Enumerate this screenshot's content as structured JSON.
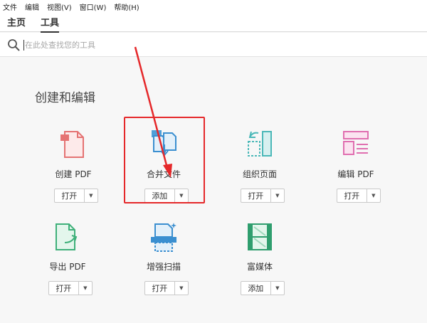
{
  "menu": [
    "文件",
    "编辑",
    "视图(V)",
    "窗口(W)",
    "帮助(H)"
  ],
  "tabs": {
    "home": "主页",
    "tools": "工具"
  },
  "search": {
    "placeholder": "在此处查找您的工具",
    "value": ""
  },
  "section": {
    "title": "创建和编辑"
  },
  "tools": [
    {
      "label": "创建 PDF",
      "button": "打开",
      "icon": "create-pdf-icon"
    },
    {
      "label": "合并文件",
      "button": "添加",
      "icon": "combine-files-icon"
    },
    {
      "label": "组织页面",
      "button": "打开",
      "icon": "organize-pages-icon"
    },
    {
      "label": "编辑 PDF",
      "button": "打开",
      "icon": "edit-pdf-icon"
    },
    {
      "label": "导出 PDF",
      "button": "打开",
      "icon": "export-pdf-icon"
    },
    {
      "label": "增强扫描",
      "button": "打开",
      "icon": "enhance-scan-icon"
    },
    {
      "label": "富媒体",
      "button": "添加",
      "icon": "rich-media-icon"
    }
  ],
  "annotation": {
    "color": "#e5282a",
    "target": "合并文件"
  }
}
